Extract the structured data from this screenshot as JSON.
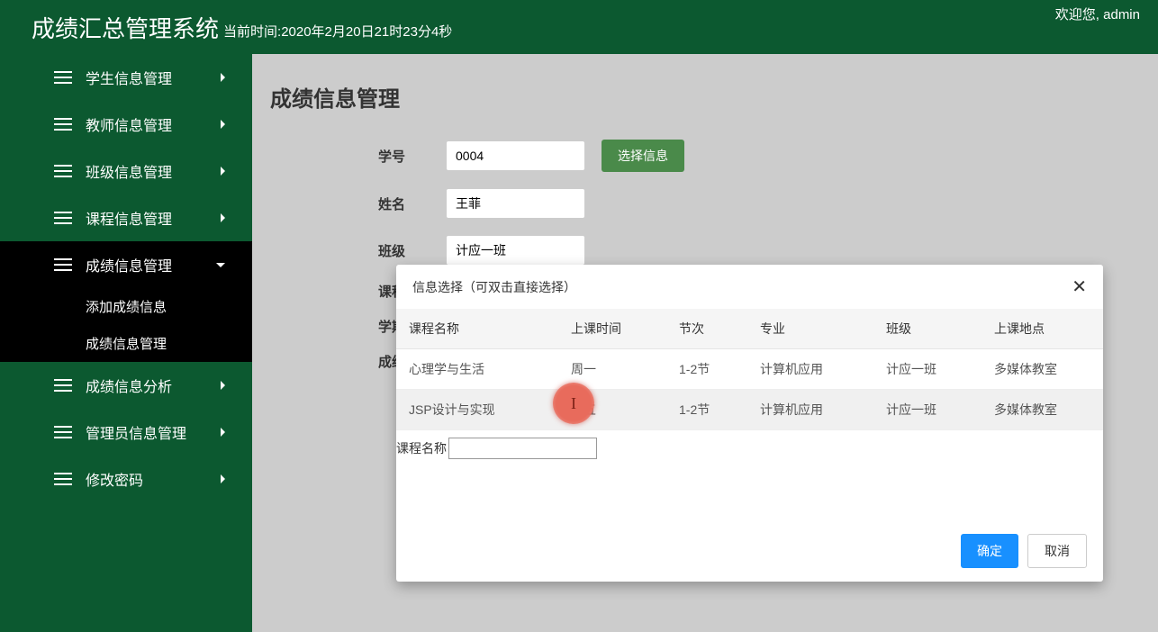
{
  "header": {
    "title": "成绩汇总管理系统",
    "time_prefix": "当前时间:",
    "time": "2020年2月20日21时23分4秒",
    "welcome": "欢迎您, admin"
  },
  "sidebar": {
    "items": [
      {
        "label": "学生信息管理",
        "expanded": false
      },
      {
        "label": "教师信息管理",
        "expanded": false
      },
      {
        "label": "班级信息管理",
        "expanded": false
      },
      {
        "label": "课程信息管理",
        "expanded": false
      },
      {
        "label": "成绩信息管理",
        "expanded": true,
        "active": true
      },
      {
        "label": "成绩信息分析",
        "expanded": false
      },
      {
        "label": "管理员信息管理",
        "expanded": false
      },
      {
        "label": "修改密码",
        "expanded": false
      }
    ],
    "submenu_grade": [
      "添加成绩信息",
      "成绩信息管理"
    ]
  },
  "main": {
    "page_title": "成绩信息管理",
    "form": {
      "student_id_label": "学号",
      "student_id_value": "0004",
      "select_btn": "选择信息",
      "name_label": "姓名",
      "name_value": "王菲",
      "class_label": "班级",
      "class_value": "计应一班",
      "course_label": "课程",
      "semester_label": "学期",
      "grade_label": "成绩"
    }
  },
  "modal": {
    "title": "信息选择（可双击直接选择）",
    "headers": [
      "课程名称",
      "上课时间",
      "节次",
      "专业",
      "班级",
      "上课地点"
    ],
    "rows": [
      {
        "course": "心理学与生活",
        "time": "周一",
        "section": "1-2节",
        "major": "计算机应用",
        "class": "计应一班",
        "location": "多媒体教室"
      },
      {
        "course": "JSP设计与实现",
        "time": "周五",
        "section": "1-2节",
        "major": "计算机应用",
        "class": "计应一班",
        "location": "多媒体教室"
      }
    ],
    "filter_label": "课程名称",
    "ok": "确定",
    "cancel": "取消"
  }
}
